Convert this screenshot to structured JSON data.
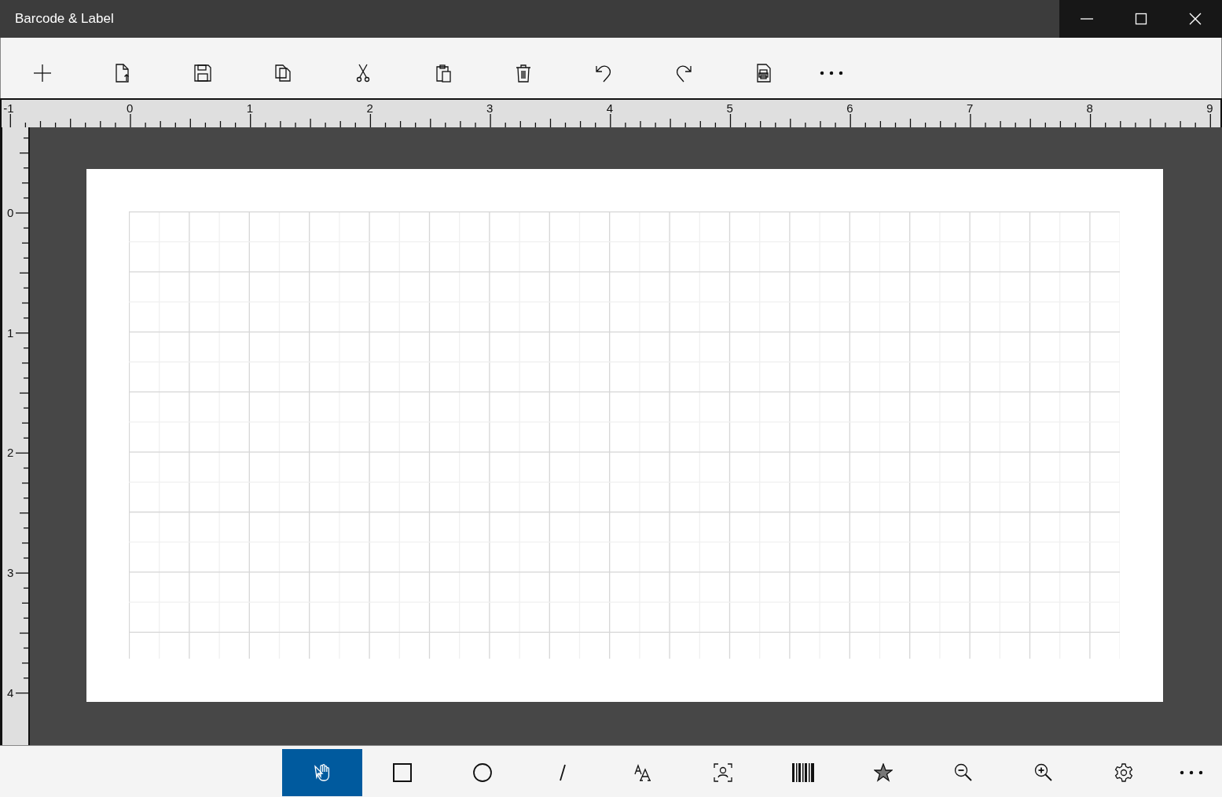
{
  "window": {
    "title": "Barcode & Label"
  },
  "ruler_horizontal": {
    "labels": [
      "-1",
      "0",
      "1",
      "2",
      "3",
      "4",
      "5",
      "6",
      "7",
      "8",
      "9"
    ]
  },
  "ruler_vertical": {
    "labels": [
      "0",
      "1",
      "2",
      "3",
      "4"
    ]
  },
  "tools": [
    {
      "selected": true
    },
    {
      "selected": false
    },
    {
      "selected": false
    },
    {
      "selected": false
    },
    {
      "selected": false
    },
    {
      "selected": false
    },
    {
      "selected": false
    },
    {
      "selected": false
    },
    {
      "selected": false
    },
    {
      "selected": false
    },
    {
      "selected": false
    }
  ]
}
